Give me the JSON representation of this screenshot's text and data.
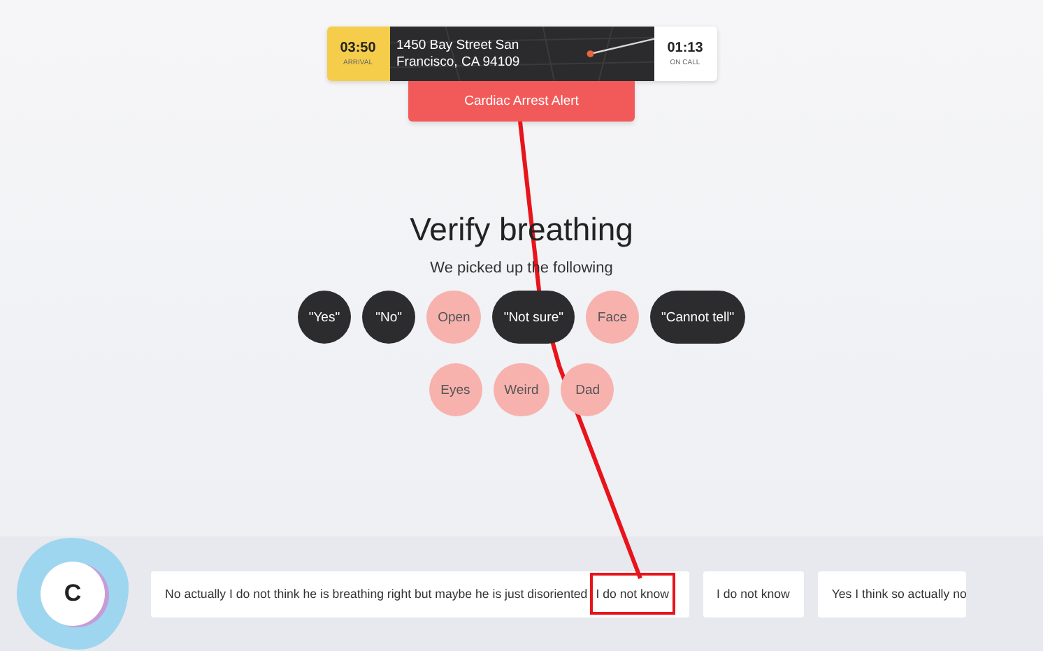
{
  "call_banner": {
    "arrival_time": "03:50",
    "arrival_label": "ARRIVAL",
    "address": "1450 Bay Street San Francisco, CA 94109",
    "call_time": "01:13",
    "call_label": "ON CALL"
  },
  "alert": {
    "label": "Cardiac Arrest Alert"
  },
  "heading": "Verify breathing",
  "subheading": "We picked up the following",
  "chip_rows": [
    [
      {
        "label": "\"Yes\"",
        "kind": "quote"
      },
      {
        "label": "\"No\"",
        "kind": "quote"
      },
      {
        "label": "Open",
        "kind": "keyword"
      },
      {
        "label": "\"Not sure\"",
        "kind": "quote"
      },
      {
        "label": "Face",
        "kind": "keyword"
      },
      {
        "label": "\"Cannot tell\"",
        "kind": "quote"
      }
    ],
    [
      {
        "label": "Eyes",
        "kind": "keyword"
      },
      {
        "label": "Weird",
        "kind": "keyword"
      },
      {
        "label": "Dad",
        "kind": "keyword"
      }
    ]
  ],
  "caller": {
    "initial": "C"
  },
  "transcripts": [
    {
      "segments": [
        {
          "text": "No actually I do not think he is breathing right but maybe he is just disoriented",
          "highlighted": false
        },
        {
          "text": "I do not know",
          "highlighted": true
        }
      ]
    },
    {
      "segments": [
        {
          "text": "I do not know",
          "highlighted": false
        }
      ]
    },
    {
      "segments": [
        {
          "text": "Yes I think so actually no",
          "highlighted": false
        }
      ]
    }
  ]
}
